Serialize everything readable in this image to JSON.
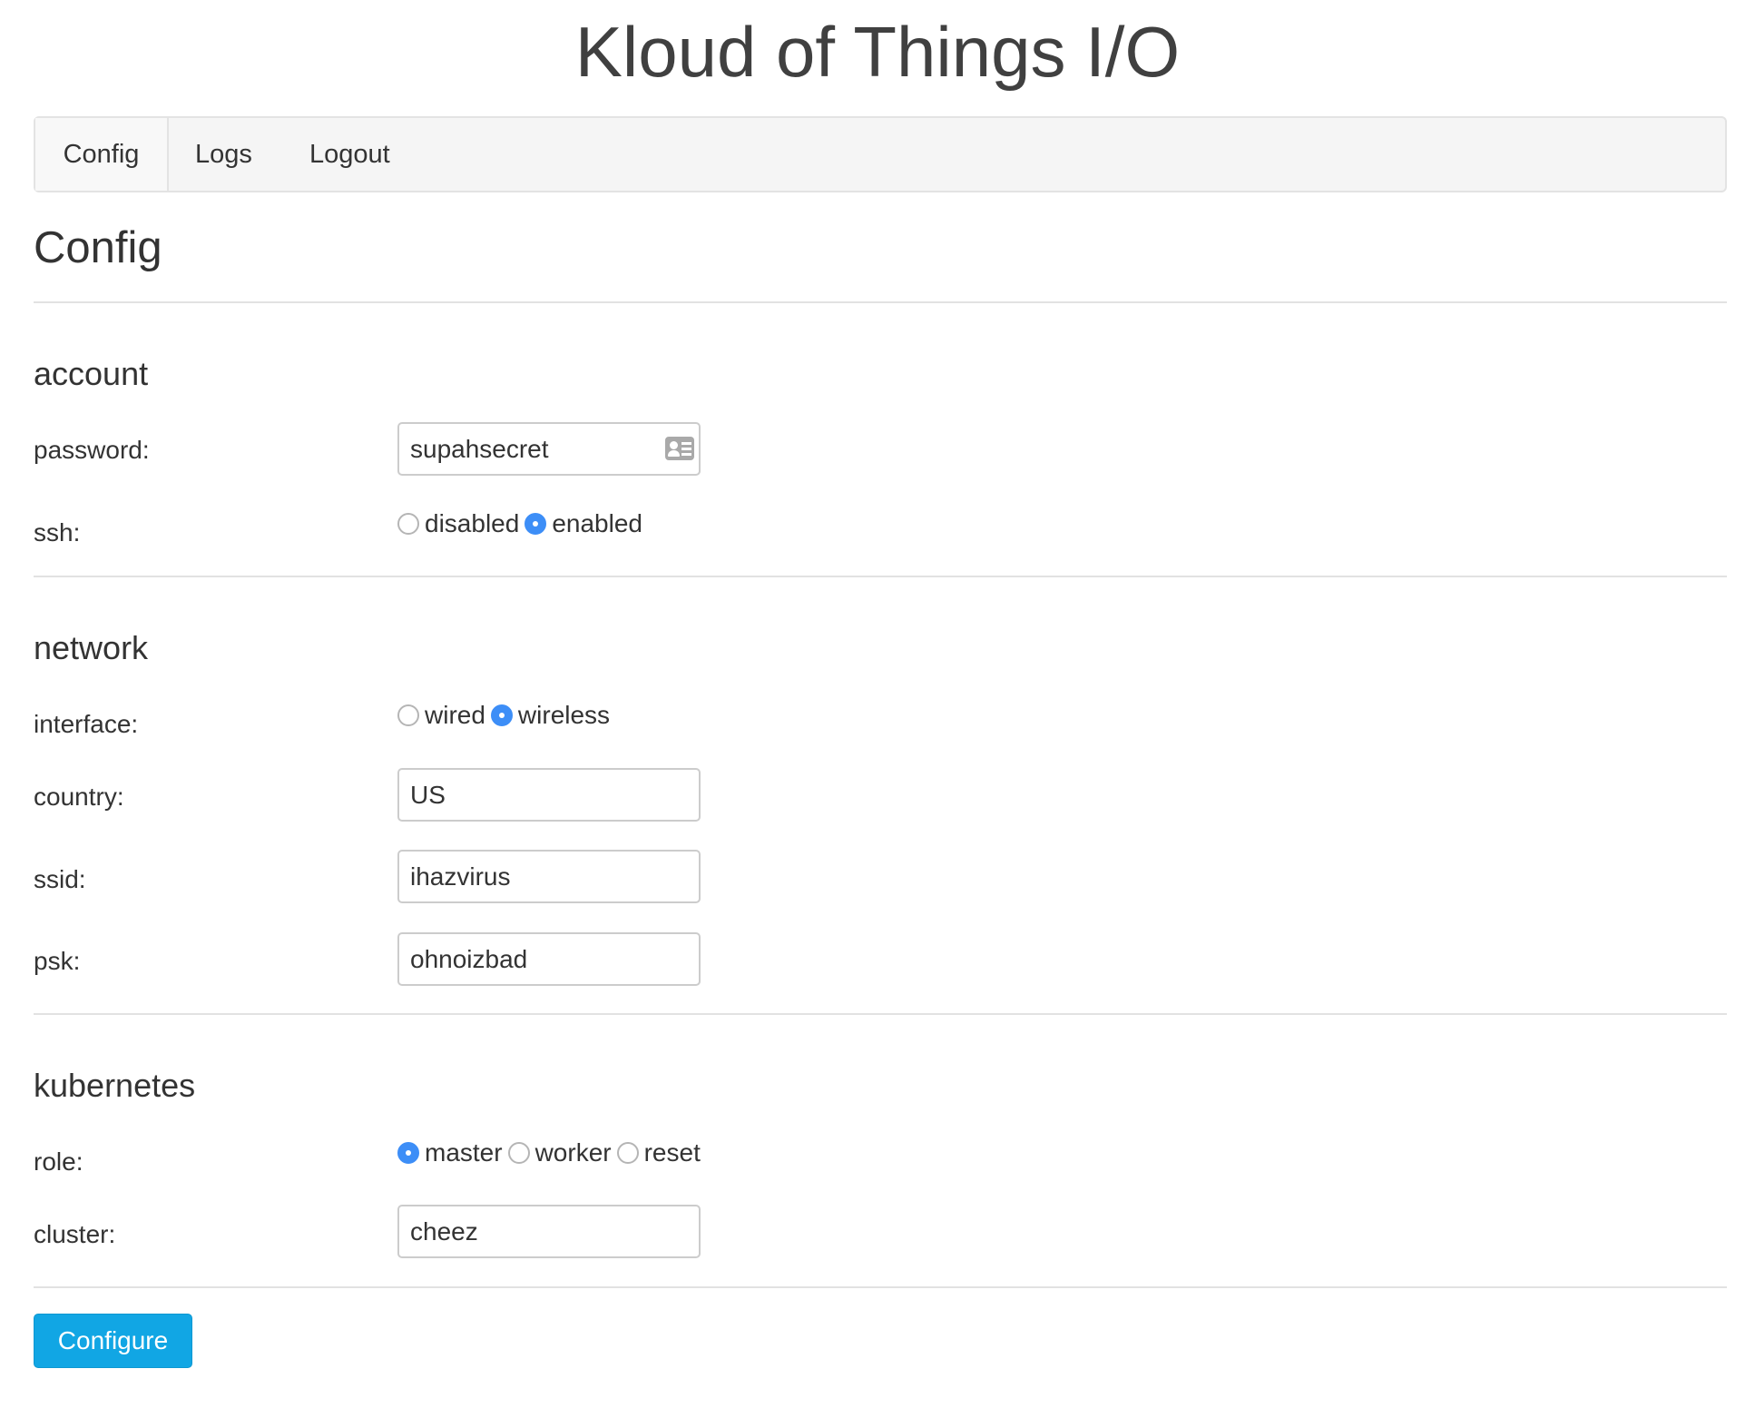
{
  "app": {
    "title": "Kloud of Things I/O"
  },
  "nav": {
    "items": [
      "Config",
      "Logs",
      "Logout"
    ],
    "active": "Config"
  },
  "page": {
    "title": "Config"
  },
  "account": {
    "title": "account",
    "password_label": "password:",
    "password_value": "supahsecret",
    "ssh_label": "ssh:",
    "ssh_options": [
      "disabled",
      "enabled"
    ],
    "ssh_selected": "enabled"
  },
  "network": {
    "title": "network",
    "interface_label": "interface:",
    "interface_options": [
      "wired",
      "wireless"
    ],
    "interface_selected": "wireless",
    "country_label": "country:",
    "country_value": "US",
    "ssid_label": "ssid:",
    "ssid_value": "ihazvirus",
    "psk_label": "psk:",
    "psk_value": "ohnoizbad"
  },
  "kubernetes": {
    "title": "kubernetes",
    "role_label": "role:",
    "role_options": [
      "master",
      "worker",
      "reset"
    ],
    "role_selected": "master",
    "cluster_label": "cluster:",
    "cluster_value": "cheez"
  },
  "actions": {
    "configure_label": "Configure"
  },
  "colors": {
    "primary_button": "#11a6e4",
    "radio_checked": "#3d8ef7"
  }
}
